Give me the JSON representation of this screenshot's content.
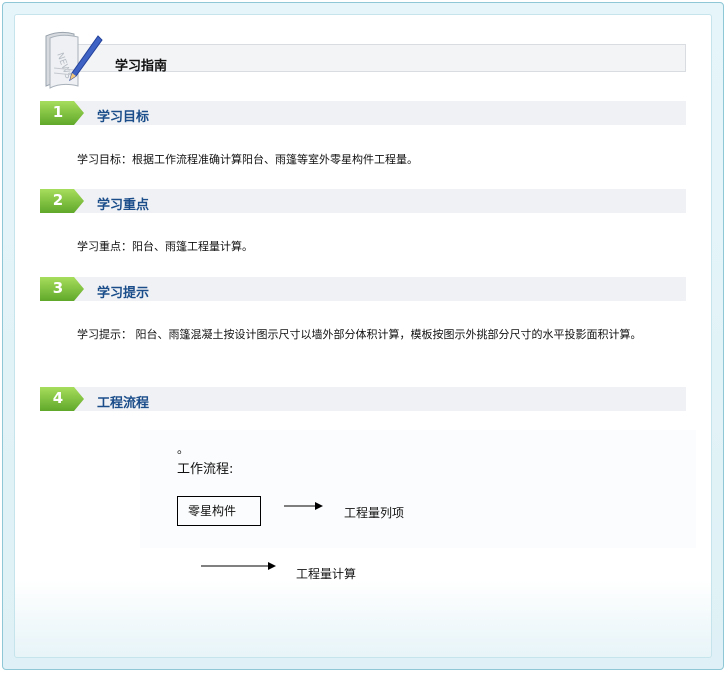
{
  "header": {
    "title": "学习指南"
  },
  "sections": [
    {
      "num": "1",
      "title": "学习目标",
      "text": "学习目标：根据工作流程准确计算阳台、雨篷等室外零星构件工程量。"
    },
    {
      "num": "2",
      "title": "学习重点",
      "text": "学习重点：阳台、雨篷工程量计算。"
    },
    {
      "num": "3",
      "title": "学习提示",
      "text": "学习提示：  阳台、雨篷混凝土按设计图示尺寸以墙外部分体积计算，模板按图示外挑部分尺寸的水平投影面积计算。"
    },
    {
      "num": "4",
      "title": "工程流程"
    }
  ],
  "flow": {
    "dot": "。",
    "title": "工作流程:",
    "component": "零星构件",
    "item_list": "工程量列项",
    "item_calc": "工程量计算"
  },
  "colors": {
    "badge_green": "#7ec23a",
    "title_blue": "#1a4d8a",
    "frame_border": "#8fc7d6"
  },
  "icons": {
    "logo": "news-paper-pencil-icon",
    "badge": "green-arrow-badge-icon"
  }
}
